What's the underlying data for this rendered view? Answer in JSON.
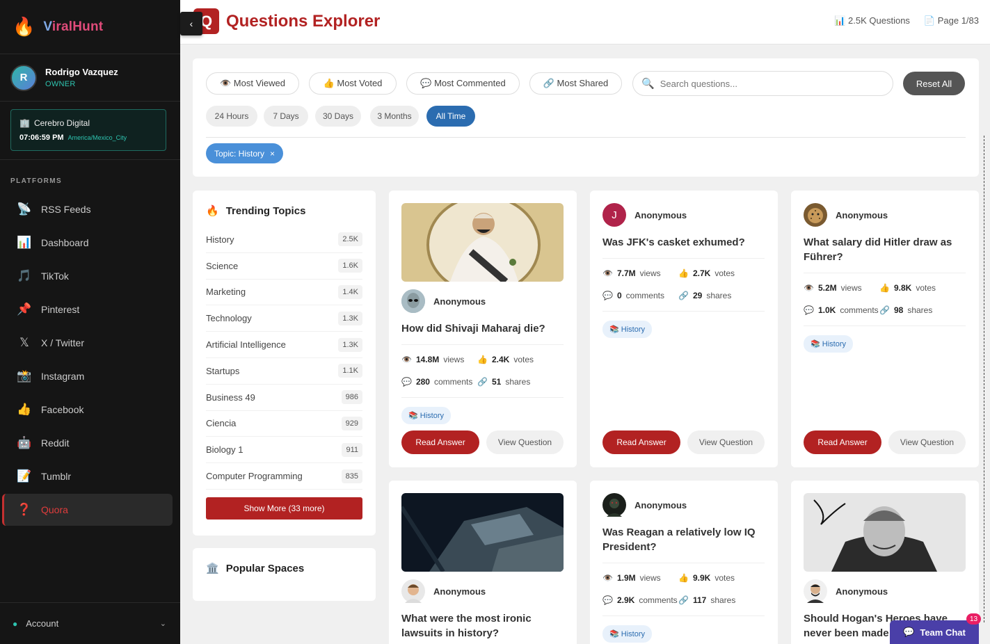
{
  "brand": {
    "name_prefix": "V",
    "name_rest": "iralHunt",
    "icon": "flame-icon"
  },
  "user": {
    "initial": "R",
    "name": "Rodrigo Vazquez",
    "role": "OWNER"
  },
  "org": {
    "name": "Cerebro Digital",
    "time": "07:06:59 PM",
    "timezone": "America/Mexico_City"
  },
  "sidebar": {
    "section_title": "PLATFORMS",
    "items": [
      {
        "label": "RSS Feeds",
        "icon": "📡"
      },
      {
        "label": "Dashboard",
        "icon": "📊"
      },
      {
        "label": "TikTok",
        "icon": "🎵"
      },
      {
        "label": "Pinterest",
        "icon": "📌"
      },
      {
        "label": "X / Twitter",
        "icon": "𝕏"
      },
      {
        "label": "Instagram",
        "icon": "📸"
      },
      {
        "label": "Facebook",
        "icon": "👍"
      },
      {
        "label": "Reddit",
        "icon": "🤖"
      },
      {
        "label": "Tumblr",
        "icon": "📝"
      },
      {
        "label": "Quora",
        "icon": "❓"
      }
    ],
    "active_item": "Quora",
    "account_label": "Account"
  },
  "header": {
    "logo_letter": "Q",
    "title": "Questions Explorer",
    "questions_count": "📊 2.5K Questions",
    "page_info": "📄 Page 1/83"
  },
  "filters": {
    "sort_options": [
      "👁️ Most Viewed",
      "👍 Most Voted",
      "💬 Most Commented",
      "🔗 Most Shared"
    ],
    "search_placeholder": "Search questions...",
    "reset_label": "Reset All",
    "time_ranges": [
      "24 Hours",
      "7 Days",
      "30 Days",
      "3 Months",
      "All Time"
    ],
    "active_time_range": "All Time",
    "active_tag": "Topic: History",
    "tag_remove": "×"
  },
  "trending": {
    "title": "Trending Topics",
    "topics": [
      {
        "name": "History",
        "count": "2.5K"
      },
      {
        "name": "Science",
        "count": "1.6K"
      },
      {
        "name": "Marketing",
        "count": "1.4K"
      },
      {
        "name": "Technology",
        "count": "1.3K"
      },
      {
        "name": "Artificial Intelligence",
        "count": "1.3K"
      },
      {
        "name": "Startups",
        "count": "1.1K"
      },
      {
        "name": "Business 49",
        "count": "986"
      },
      {
        "name": "Ciencia",
        "count": "929"
      },
      {
        "name": "Biology 1",
        "count": "911"
      },
      {
        "name": "Computer Programming",
        "count": "835"
      }
    ],
    "show_more": "Show More (33 more)"
  },
  "spaces": {
    "title": "Popular Spaces"
  },
  "cards": [
    {
      "author": "Anonymous",
      "title": "How did Shivaji Maharaj die?",
      "views": "14.8M",
      "votes": "2.4K",
      "comments": "280",
      "shares": "51",
      "tag": "📚 History"
    },
    {
      "author": "Anonymous",
      "avatar_initial": "J",
      "title": "Was JFK's casket exhumed?",
      "views": "7.7M",
      "votes": "2.7K",
      "comments": "0",
      "shares": "29",
      "tag": "📚 History"
    },
    {
      "author": "Anonymous",
      "title": "What salary did Hitler draw as Führer?",
      "views": "5.2M",
      "votes": "9.8K",
      "comments": "1.0K",
      "shares": "98",
      "tag": "📚 History"
    },
    {
      "author": "Anonymous",
      "title": "What were the most ironic lawsuits in history?"
    },
    {
      "author": "Anonymous",
      "title": "Was Reagan a relatively low IQ President?",
      "views": "1.9M",
      "votes": "9.9K",
      "comments": "2.9K",
      "shares": "117",
      "tag": "📚 History"
    },
    {
      "author": "Anonymous",
      "title": "Should Hogan's Heroes have never been made"
    }
  ],
  "labels": {
    "views": "views",
    "votes": "votes",
    "comments": "comments",
    "shares": "shares",
    "read": "Read Answer",
    "view": "View Question"
  },
  "chat": {
    "label": "Team Chat",
    "badge": "13"
  },
  "colors": {
    "accent": "#b22222",
    "active_blue": "#2b6cb0",
    "sidebar_bg": "#151515",
    "teal": "#2ec4b0"
  }
}
